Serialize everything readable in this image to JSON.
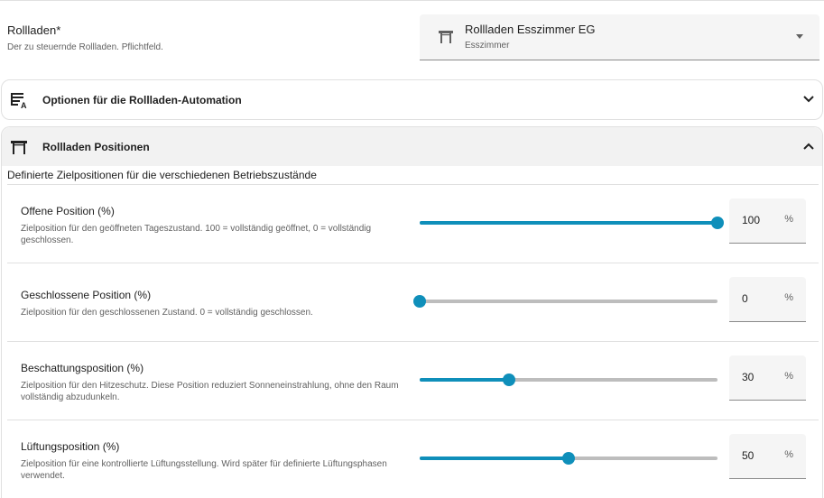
{
  "entity": {
    "label": "Rollladen*",
    "description": "Der zu steuernde Rollladen. Pflichtfeld.",
    "selected_title": "Rollladen Esszimmer EG",
    "selected_subtitle": "Esszimmer",
    "icon": "window-shutter-icon"
  },
  "panels": [
    {
      "title": "Optionen für die Rollladen-Automation",
      "icon": "text-box-settings-icon",
      "expanded": false
    },
    {
      "title": "Rollladen Positionen",
      "icon": "window-shutter-icon",
      "expanded": true
    }
  ],
  "positions": {
    "description": "Definierte Zielpositionen für die verschiedenen Betriebszustände",
    "accent_color": "#0f8fba",
    "unit": "%",
    "rows": [
      {
        "title": "Offene Position (%)",
        "description": "Zielposition für den geöffneten Tageszustand. 100 = vollständig geöffnet, 0 = vollständig geschlossen.",
        "value": "100"
      },
      {
        "title": "Geschlossene Position (%)",
        "description": "Zielposition für den geschlossenen Zustand. 0 = vollständig geschlossen.",
        "value": "0"
      },
      {
        "title": "Beschattungsposition (%)",
        "description": "Zielposition für den Hitzeschutz. Diese Position reduziert Sonneneinstrahlung, ohne den Raum vollständig abzudunkeln.",
        "value": "30"
      },
      {
        "title": "Lüftungsposition (%)",
        "description": "Zielposition für eine kontrollierte Lüftungsstellung. Wird später für definierte Lüftungsphasen verwendet.",
        "value": "50"
      }
    ]
  }
}
